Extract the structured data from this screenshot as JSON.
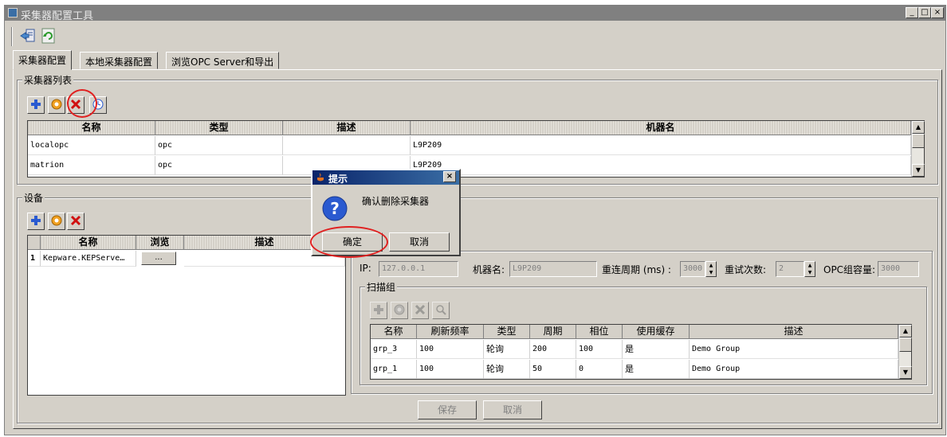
{
  "window": {
    "title": "采集器配置工具",
    "min": "_",
    "max": "□",
    "close": "×"
  },
  "toolbar": {
    "icons": [
      "export-icon",
      "refresh-icon"
    ]
  },
  "tabs": [
    {
      "label": "采集器配置",
      "active": true
    },
    {
      "label": "本地采集器配置",
      "active": false
    },
    {
      "label": "浏览OPC Server和导出",
      "active": false
    }
  ],
  "collectors": {
    "group_label": "采集器列表",
    "columns": [
      "名称",
      "类型",
      "描述",
      "机器名"
    ],
    "rows": [
      [
        "localopc",
        "opc",
        "",
        "L9P209"
      ],
      [
        "matrion",
        "opc",
        "",
        "L9P209"
      ]
    ]
  },
  "devices": {
    "group_label": "设备",
    "columns": [
      "名称",
      "浏览",
      "描述"
    ],
    "rows": [
      {
        "index": "1",
        "name": "Kepware.KEPServe…",
        "browse": "...",
        "desc": ""
      }
    ]
  },
  "device_detail": {
    "ip_label": "IP:",
    "ip_value": "127.0.0.1",
    "machine_label": "机器名:",
    "machine_value": "L9P209",
    "reconnect_label": "重连周期 (ms) :",
    "reconnect_value": "3000",
    "retry_label": "重试次数:",
    "retry_value": "2",
    "opc_cap_label": "OPC组容量:",
    "opc_cap_value": "3000"
  },
  "scan_groups": {
    "group_label": "扫描组",
    "columns": [
      "名称",
      "刷新频率",
      "类型",
      "周期",
      "相位",
      "使用缓存",
      "描述"
    ],
    "rows": [
      [
        "grp_3",
        "100",
        "轮询",
        "200",
        "100",
        "是",
        "Demo Group"
      ],
      [
        "grp_1",
        "100",
        "轮询",
        "50",
        "0",
        "是",
        "Demo Group"
      ]
    ]
  },
  "footer": {
    "save_label": "保存",
    "cancel_label": "取消"
  },
  "dialog": {
    "title": "提示",
    "close": "×",
    "message": "确认删除采集器",
    "ok_label": "确定",
    "cancel_label": "取消"
  },
  "colors": {
    "titlebar": "#808080",
    "window_bg": "#d4d0c8",
    "dialog_title": "#0a246a",
    "highlight_ring": "#e02020"
  }
}
